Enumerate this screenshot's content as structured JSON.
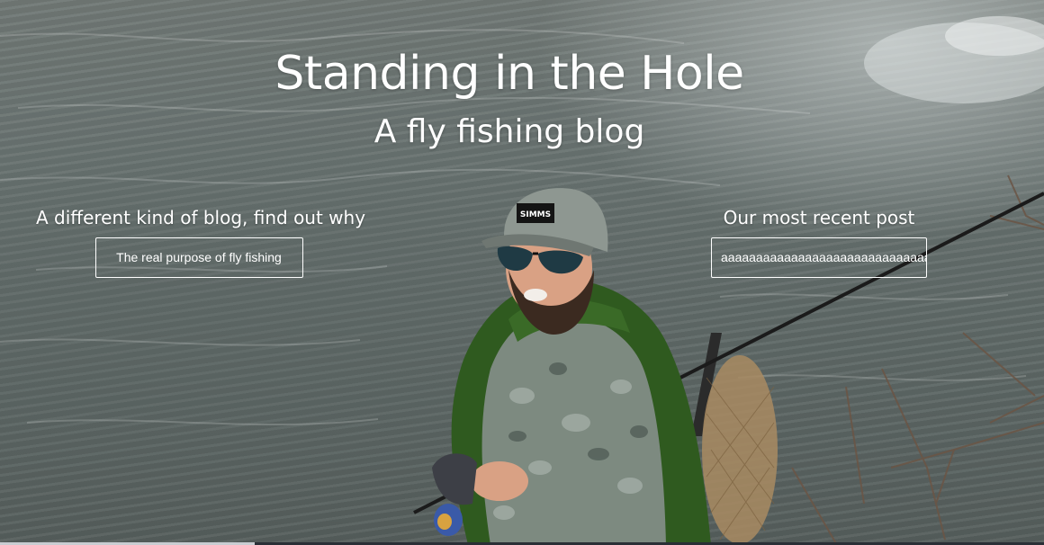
{
  "hero": {
    "title": "Standing in the Hole",
    "subtitle": "A fly fishing blog"
  },
  "promo_left": {
    "heading": "A different kind of blog, find out why",
    "button_label": "The real purpose of fly fishing"
  },
  "promo_right": {
    "heading": "Our most recent post",
    "button_label": "aaaaaaaaaaaaaaaaaaaaaaaaaaaaaaaa"
  },
  "cap": {
    "brand_text": "SIMMS"
  },
  "colors": {
    "text": "#ffffff",
    "jacket": "#2f5a1f",
    "water": "#66706e"
  }
}
